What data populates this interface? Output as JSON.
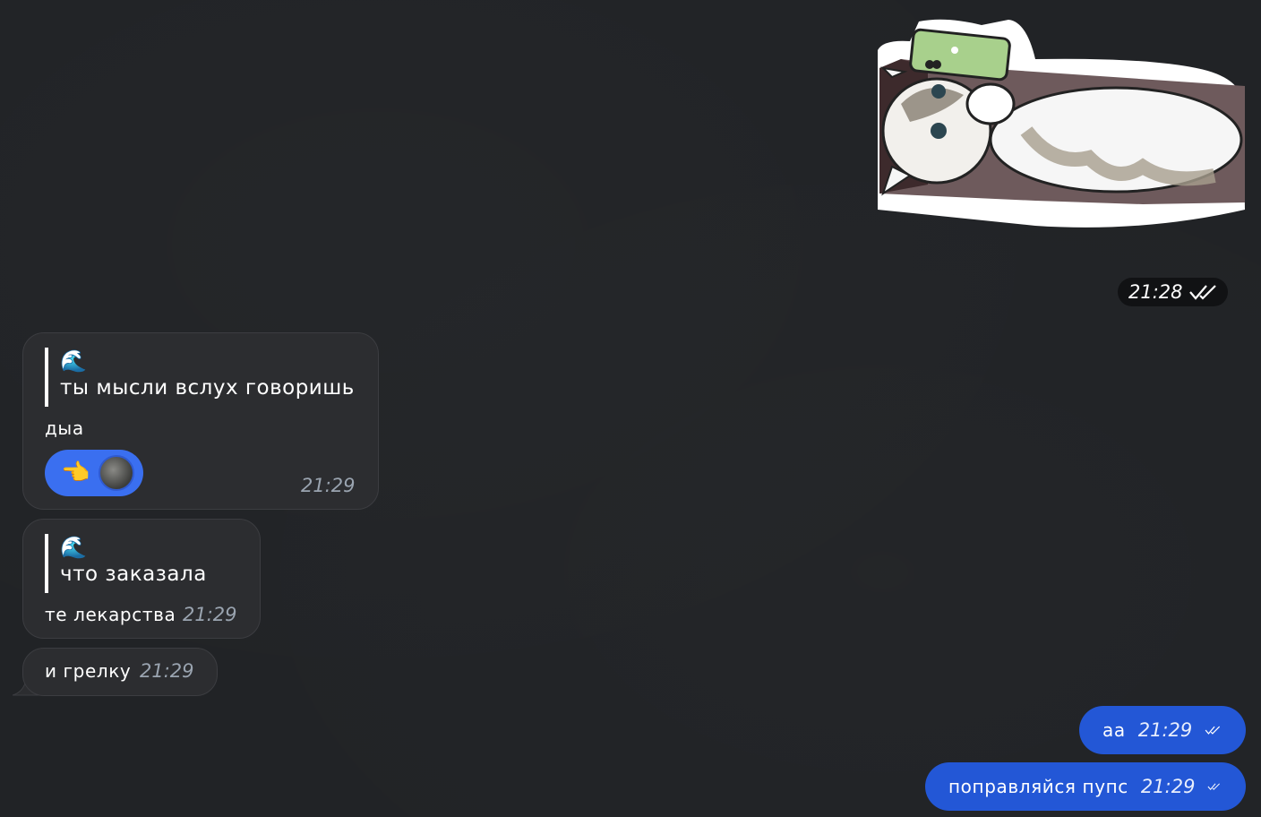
{
  "sticker": {
    "time": "21:28"
  },
  "messages": [
    {
      "reply": {
        "emoji": "🌊",
        "text": "ты мысли вслух говоришь"
      },
      "text": "дыа",
      "time": "21:29",
      "reaction": {
        "emoji": "👈"
      }
    },
    {
      "reply": {
        "emoji": "🌊",
        "text": "что заказала"
      },
      "text": "те лекарства",
      "time": "21:29"
    },
    {
      "text": "и грелку",
      "time": "21:29"
    }
  ],
  "outgoing": [
    {
      "text": "аа",
      "time": "21:29"
    },
    {
      "text": "поправляйся пупс",
      "time": "21:29"
    }
  ],
  "colors": {
    "background": "#212326",
    "incoming_bubble": "#2c2d30",
    "outgoing_bubble": "#2357d6",
    "reaction": "#3a6ff0"
  }
}
